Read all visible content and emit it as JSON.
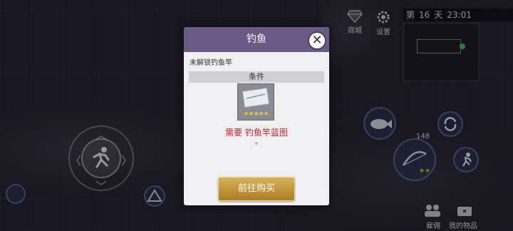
{
  "hud": {
    "shop_label": "商城",
    "settings_label": "设置",
    "day_prefix": "第",
    "day_number": "16",
    "day_suffix": "天",
    "time": "23:01",
    "arrow_count": "148",
    "hire_label": "雇佣",
    "items_label": "我的物品"
  },
  "modal": {
    "title": "钓鱼",
    "subtitle": "未解锁钓鱼竿",
    "section_title": "条件",
    "item_stars": 5,
    "requirement_text": "需要 钓鱼竿蓝图",
    "buy_button_label": "前往购买"
  }
}
